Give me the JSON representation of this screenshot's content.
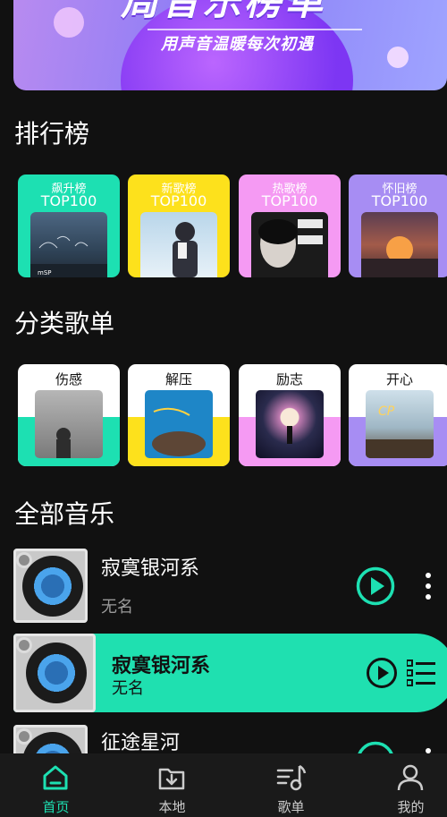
{
  "banner": {
    "title": "周音乐榜单",
    "subtitle": "用声音温暖每次初遇"
  },
  "sections": {
    "rankings": "排行榜",
    "categories": "分类歌单",
    "all_music": "全部音乐"
  },
  "rank_cards": [
    {
      "label": "飙升榜",
      "top": "TOP100",
      "color": "#1de0b2"
    },
    {
      "label": "新歌榜",
      "top": "TOP100",
      "color": "#fde11c"
    },
    {
      "label": "热歌榜",
      "top": "TOP100",
      "color": "#f59af3"
    },
    {
      "label": "怀旧榜",
      "top": "TOP100",
      "color": "#a78df3"
    }
  ],
  "category_cards": [
    {
      "label": "伤感",
      "color": "#1de0b2"
    },
    {
      "label": "解压",
      "color": "#fde11c"
    },
    {
      "label": "励志",
      "color": "#f59af3"
    },
    {
      "label": "开心",
      "color": "#a78df3"
    }
  ],
  "songs": [
    {
      "title": "寂寞银河系",
      "artist": "无名"
    },
    {
      "title": "寂寞银河系",
      "artist": "无名"
    },
    {
      "title": "征途星河",
      "artist": ""
    }
  ],
  "tabs": [
    {
      "label": "首页",
      "icon": "home-icon",
      "active": true
    },
    {
      "label": "本地",
      "icon": "download-folder-icon"
    },
    {
      "label": "歌单",
      "icon": "playlist-icon"
    },
    {
      "label": "我的",
      "icon": "user-icon"
    }
  ],
  "colors": {
    "accent": "#1de0b2",
    "background": "#111111",
    "inactive": "#cccccc"
  }
}
